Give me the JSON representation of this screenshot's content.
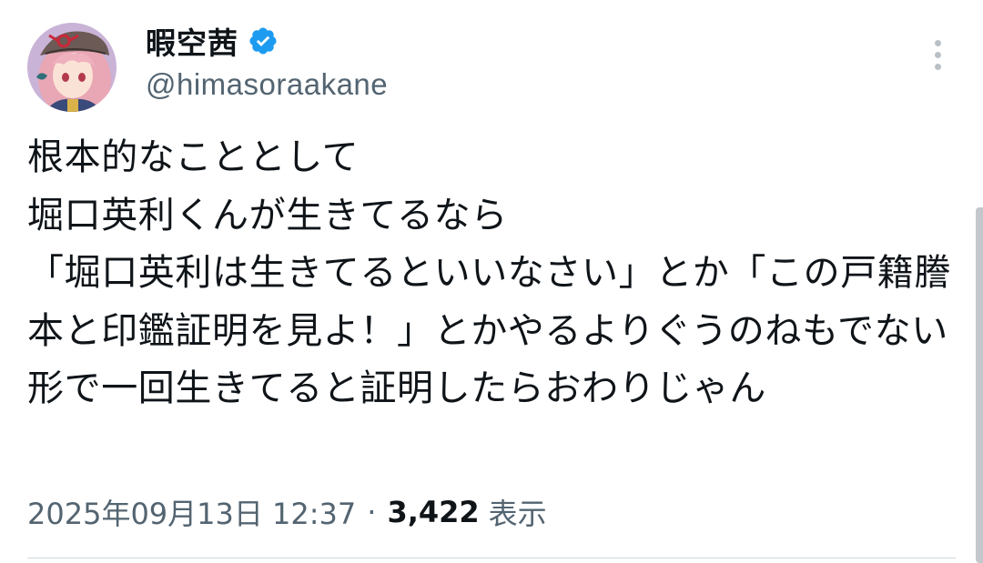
{
  "author": {
    "display_name": "暇空茜",
    "handle": "@himasoraakane",
    "verified": true,
    "avatar_icon": "anime-character-avatar-icon"
  },
  "tweet": {
    "text": "根本的なこととして\n堀口英利くんが生きてるなら\n「堀口英利は生きてるといいなさい」とか「この戸籍謄本と印鑑証明を見よ！」とかやるよりぐうのねもでない形で一回生きてると証明したらおわりじゃん"
  },
  "meta": {
    "timestamp": "2025年09月13日 12:37",
    "separator": "·",
    "views_count": "3,422",
    "views_label": "表示"
  },
  "colors": {
    "text_primary": "#0f1419",
    "text_secondary": "#536471",
    "verified_blue": "#1d9bf0",
    "divider": "#cfd9de"
  },
  "icons": {
    "more": "more-vertical-icon",
    "verified": "verified-badge-icon"
  }
}
